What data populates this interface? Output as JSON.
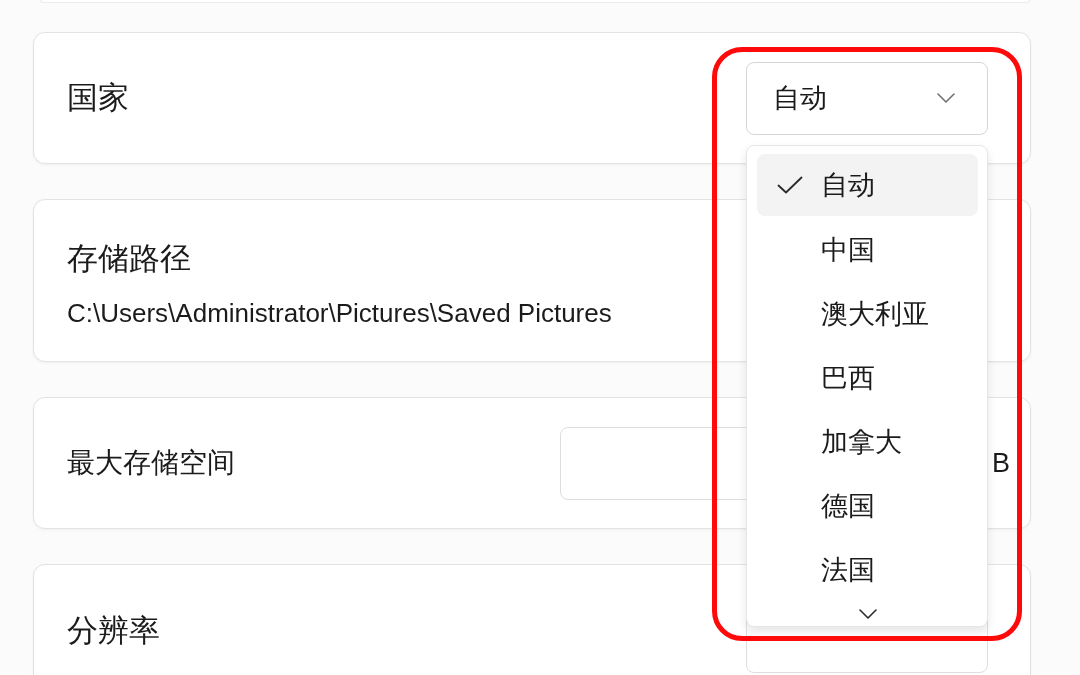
{
  "settings": [
    {
      "kind": "select",
      "label": "国家",
      "value": "自动",
      "expanded": true,
      "options": [
        {
          "label": "自动",
          "selected": true
        },
        {
          "label": "中国",
          "selected": false
        },
        {
          "label": "澳大利亚",
          "selected": false
        },
        {
          "label": "巴西",
          "selected": false
        },
        {
          "label": "加拿大",
          "selected": false
        },
        {
          "label": "德国",
          "selected": false
        },
        {
          "label": "法国",
          "selected": false
        }
      ]
    },
    {
      "kind": "path",
      "label": "存储路径",
      "value": "C:\\Users\\Administrator\\Pictures\\Saved Pictures"
    },
    {
      "kind": "number",
      "label": "最大存储空间",
      "unit": "B"
    },
    {
      "kind": "select",
      "label": "分辨率",
      "expanded": false
    }
  ]
}
